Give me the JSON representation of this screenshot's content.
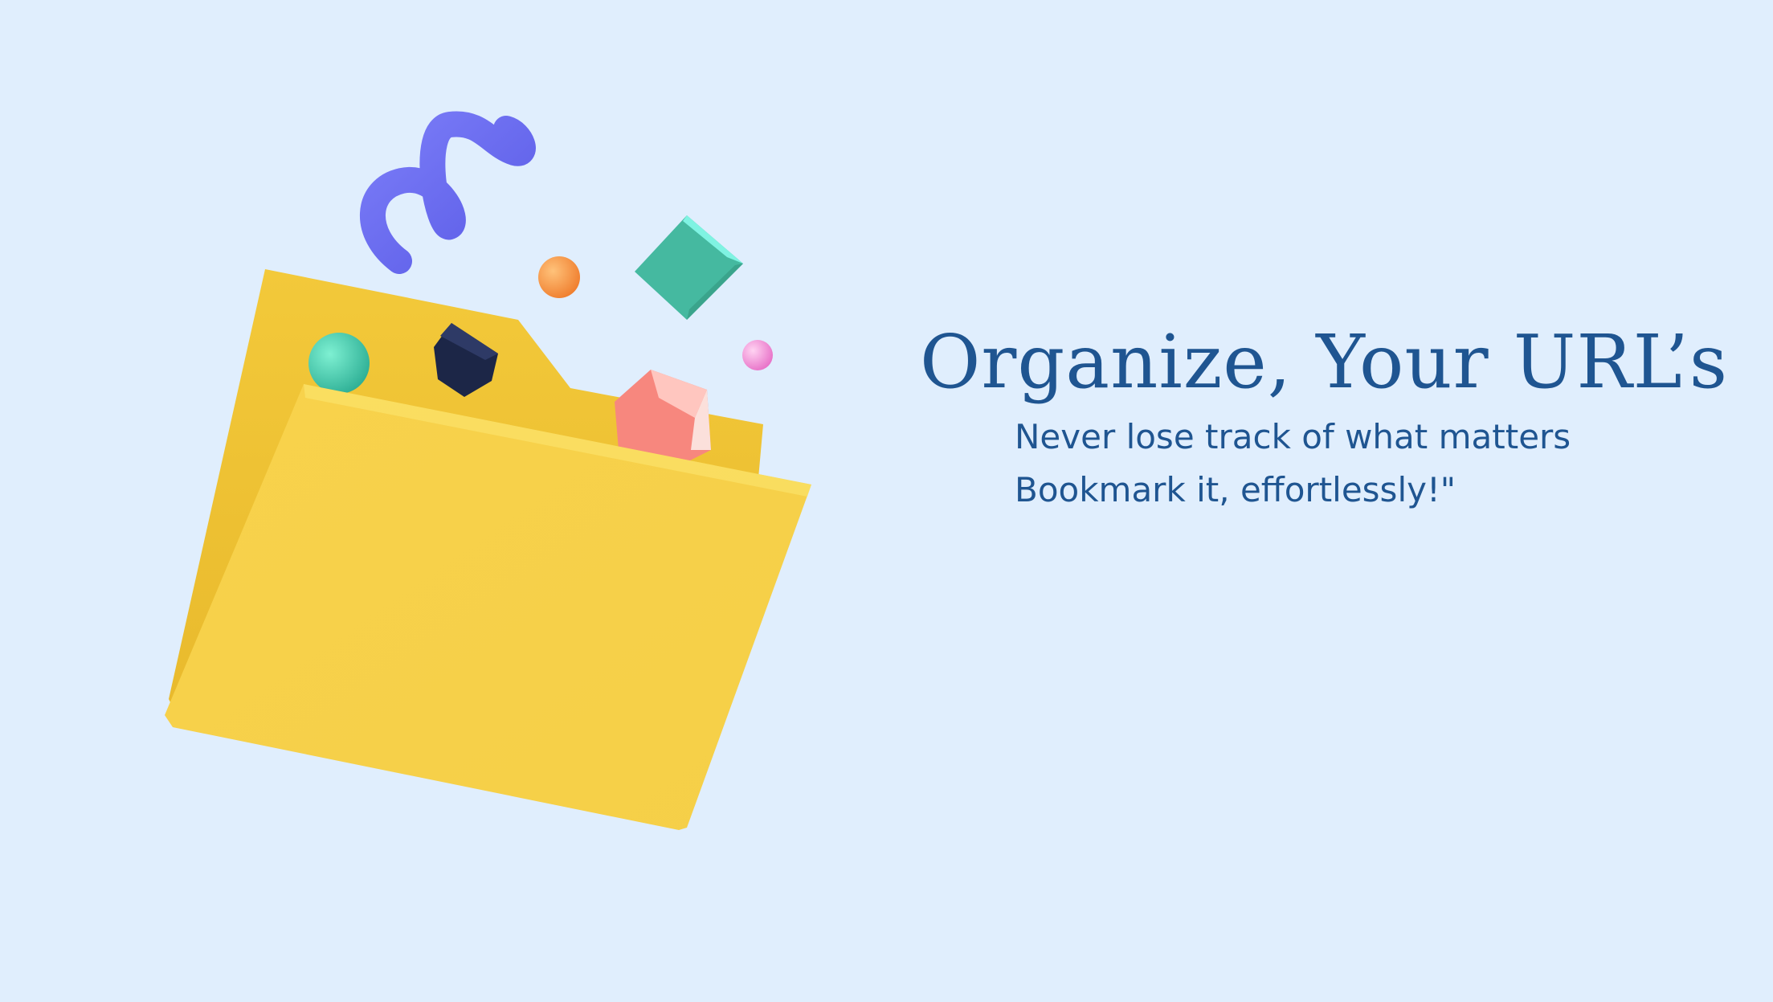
{
  "hero": {
    "title": "Organize, Your URL’s",
    "subtitle_line1": "Never lose track of what matters",
    "subtitle_line2": "Bookmark it, effortlessly!\""
  },
  "illustration": {
    "subject": "folder-icon",
    "decorations": [
      "squiggle-icon",
      "sphere-icon",
      "cube-icon",
      "gem-icon"
    ]
  },
  "colors": {
    "background": "#e0eefd",
    "text": "#1f5591",
    "folder": "#f7cf45",
    "squiggle": "#6b6cf2",
    "teal": "#45c2a6",
    "orange": "#f5953f",
    "pink": "#f08fd6",
    "navy": "#1c2647",
    "coral": "#f7877e"
  }
}
